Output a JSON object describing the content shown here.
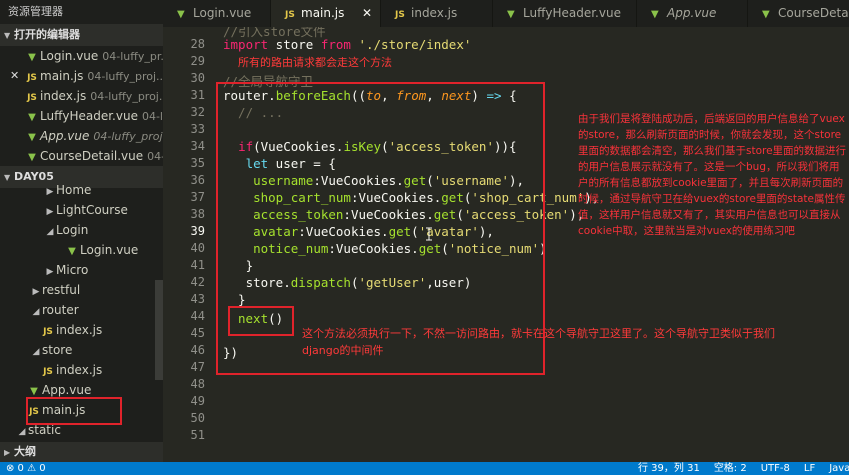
{
  "sidebar": {
    "title": "资源管理器",
    "open_editors_label": "打开的编辑器",
    "open_editors": [
      {
        "type": "vue",
        "name": "Login.vue",
        "desc": "04-luffy_pr...",
        "italic": false,
        "active": false,
        "close": false
      },
      {
        "type": "js",
        "name": "main.js",
        "desc": "04-luffy_proj...",
        "italic": false,
        "active": false,
        "close": true
      },
      {
        "type": "js",
        "name": "index.js",
        "desc": "04-luffy_proj...",
        "italic": false,
        "active": false,
        "close": false
      },
      {
        "type": "vue",
        "name": "LuffyHeader.vue",
        "desc": "04-l...",
        "italic": false,
        "active": false,
        "close": false
      },
      {
        "type": "vue",
        "name": "App.vue",
        "desc": "04-luffy_proj...",
        "italic": true,
        "active": false,
        "close": false
      },
      {
        "type": "vue",
        "name": "CourseDetail.vue",
        "desc": "04-l...",
        "italic": false,
        "active": false,
        "close": false
      }
    ],
    "project_label": "DAY05",
    "tree": [
      {
        "name": "Home",
        "kind": "folder-closed",
        "indent": 44
      },
      {
        "name": "LightCourse",
        "kind": "folder-closed",
        "indent": 44
      },
      {
        "name": "Login",
        "kind": "folder-open",
        "indent": 44
      },
      {
        "name": "Login.vue",
        "kind": "vue",
        "indent": 64
      },
      {
        "name": "Micro",
        "kind": "folder-closed",
        "indent": 44
      },
      {
        "name": "restful",
        "kind": "folder-closed",
        "indent": 30
      },
      {
        "name": "router",
        "kind": "folder-open",
        "indent": 30
      },
      {
        "name": "index.js",
        "kind": "js",
        "indent": 40
      },
      {
        "name": "store",
        "kind": "folder-open",
        "indent": 30
      },
      {
        "name": "index.js",
        "kind": "js",
        "indent": 40
      },
      {
        "name": "App.vue",
        "kind": "vue",
        "indent": 26
      },
      {
        "name": "main.js",
        "kind": "js",
        "indent": 26
      },
      {
        "name": "static",
        "kind": "folder-open",
        "indent": 16
      }
    ],
    "outline_label": "大纲"
  },
  "tabs": [
    {
      "type": "vue",
      "label": "Login.vue",
      "active": false,
      "italic": false,
      "close": false
    },
    {
      "type": "js",
      "label": "main.js",
      "active": true,
      "italic": false,
      "close": true
    },
    {
      "type": "js",
      "label": "index.js",
      "active": false,
      "italic": false,
      "close": false
    },
    {
      "type": "vue",
      "label": "LuffyHeader.vue",
      "active": false,
      "italic": false,
      "close": false
    },
    {
      "type": "vue",
      "label": "App.vue",
      "active": false,
      "italic": true,
      "close": false
    },
    {
      "type": "vue",
      "label": "CourseDetail.vue",
      "active": false,
      "italic": false,
      "close": false
    }
  ],
  "editor": {
    "line_numbers": [
      "28",
      "29",
      "30",
      "31",
      "32",
      "33",
      "34",
      "35",
      "36",
      "37",
      "38",
      "39",
      "40",
      "41",
      "42",
      "43",
      "44",
      "45",
      "46",
      "47",
      "48",
      "49",
      "50",
      "51"
    ],
    "current_line": "39",
    "top_partial_comment": "//引入store文件",
    "annotations": {
      "line29": "所有的路由请求都会走这个方法",
      "line30": "//全局导航守卫",
      "right_note": "由于我们是将登陆成功后，后端返回的用户信息给了vuex的store，那么刷新页面的时候，你就会发现，这个store里面的数据都会清空，那么我们基于store里面的数据进行的用户信息展示就没有了。这是一个bug，所以我们将用户的所有信息都放到cookie里面了，并且每次刷新页面的时候，通过导航守卫在给vuex的store里面的state属性传值，这样用户信息就又有了，其实用户信息也可以直接从cookie中取，这里就当是对vuex的使用练习吧",
      "bottom_note_1": "这个方法必须执行一下，不然一访问路由，就卡在这个导航守卫这里了。这个导航守卫类似于我们",
      "bottom_note_2": "django的中间件"
    }
  },
  "status": {
    "left": "⊗ 0  ⚠ 0",
    "items": [
      "行 39，列 31",
      "空格: 2",
      "UTF-8",
      "LF",
      "Java"
    ]
  },
  "colors": {
    "accent": "#007acc",
    "annotation_red": "#e0232b"
  }
}
